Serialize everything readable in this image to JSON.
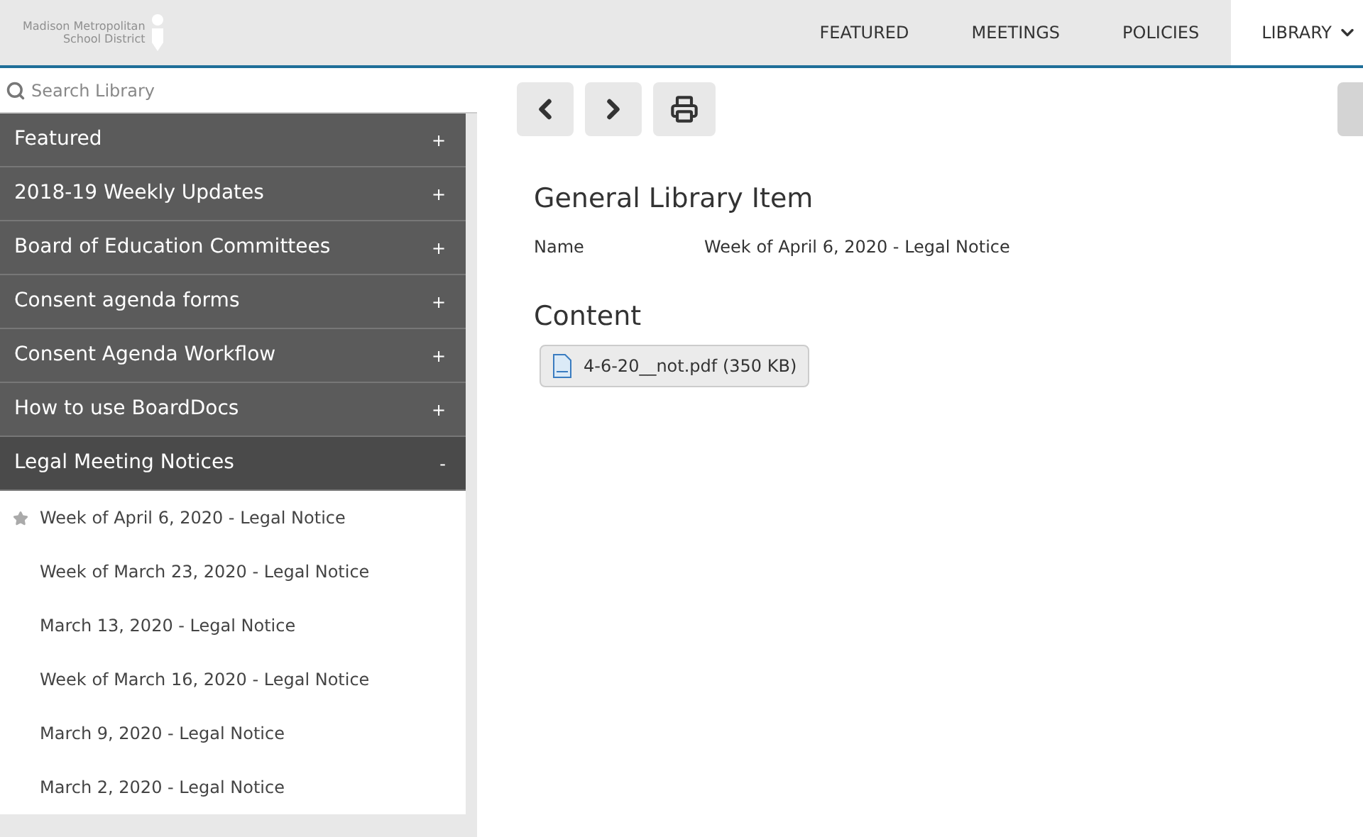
{
  "logo": {
    "lines": [
      "Madison Metropolitan",
      "School District"
    ]
  },
  "nav_tabs": [
    {
      "label": "FEATURED",
      "selected": false
    },
    {
      "label": "MEETINGS",
      "selected": false
    },
    {
      "label": "POLICIES",
      "selected": false
    },
    {
      "label": "LIBRARY",
      "selected": true
    }
  ],
  "search": {
    "placeholder": "Search Library"
  },
  "sidebar": {
    "categories": [
      {
        "label": "Featured",
        "expanded": false,
        "toggle": "+"
      },
      {
        "label": "2018-19 Weekly Updates",
        "expanded": false,
        "toggle": "+"
      },
      {
        "label": "Board of Education Committees",
        "expanded": false,
        "toggle": "+"
      },
      {
        "label": "Consent agenda forms",
        "expanded": false,
        "toggle": "+"
      },
      {
        "label": "Consent Agenda Workflow",
        "expanded": false,
        "toggle": "+"
      },
      {
        "label": "How to use BoardDocs",
        "expanded": false,
        "toggle": "+"
      },
      {
        "label": "Legal Meeting Notices",
        "expanded": true,
        "toggle": "-",
        "children": [
          {
            "label": "Week of April 6, 2020 - Legal Notice",
            "selected": true
          },
          {
            "label": "Week of March 23, 2020 - Legal Notice",
            "selected": false
          },
          {
            "label": "March 13, 2020 - Legal Notice",
            "selected": false
          },
          {
            "label": "Week of March 16, 2020 - Legal Notice",
            "selected": false
          },
          {
            "label": "March 9, 2020 - Legal Notice",
            "selected": false
          },
          {
            "label": "March 2, 2020 - Legal Notice",
            "selected": false
          }
        ]
      }
    ]
  },
  "item": {
    "title": "General Library Item",
    "fields": [
      {
        "label": "Name",
        "value": "Week of April 6, 2020 - Legal Notice"
      }
    ],
    "content_heading": "Content",
    "attachments": [
      "4-6-20__not.pdf (350 KB)"
    ]
  }
}
